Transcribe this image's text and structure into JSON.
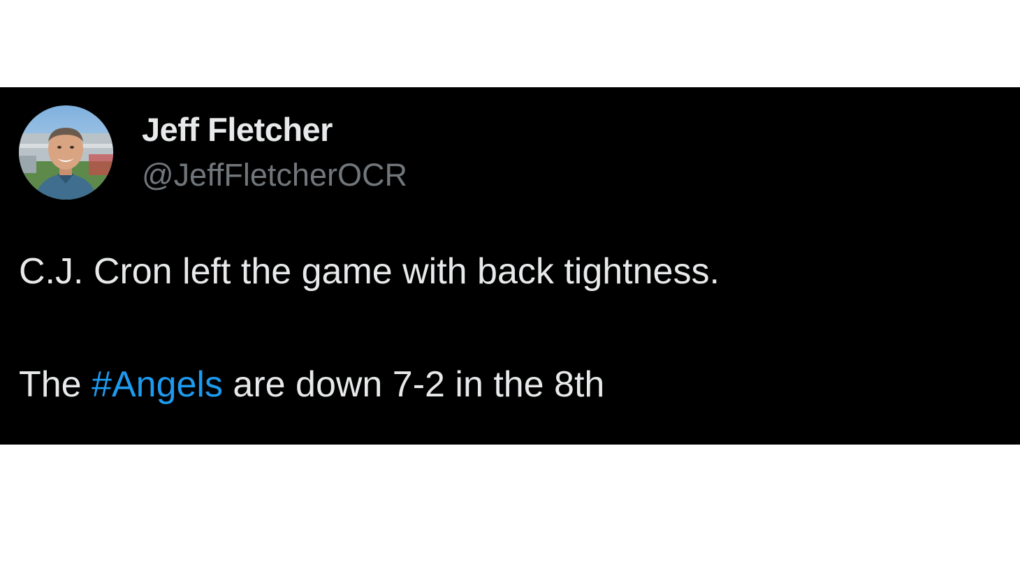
{
  "tweet": {
    "author": {
      "display_name": "Jeff Fletcher",
      "handle": "@JeffFletcherOCR",
      "avatar_icon": "profile-photo"
    },
    "text": {
      "line1": "C.J. Cron left the game with back tightness.",
      "line2_prefix": "The ",
      "hashtag": "#Angels",
      "line2_suffix": " are down 7-2 in the 8th"
    },
    "colors": {
      "background": "#000000",
      "text": "#e7e9ea",
      "handle": "#71767b",
      "hashtag": "#1d9bf0"
    }
  }
}
